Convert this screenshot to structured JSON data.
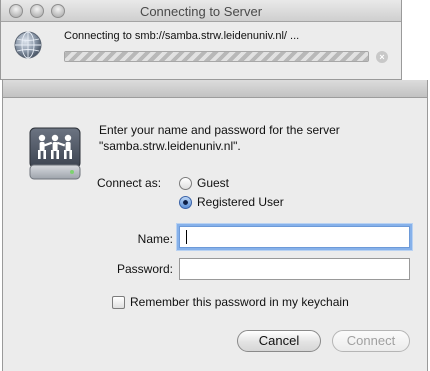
{
  "window": {
    "title": "Connecting to Server",
    "status_text": "Connecting to smb://samba.strw.leidenuniv.nl/ ..."
  },
  "progress": {
    "indeterminate": true
  },
  "dialog": {
    "prompt": "Enter your name and password for the server \"samba.strw.leidenuniv.nl\".",
    "connect_as_label": "Connect as:",
    "options": [
      {
        "label": "Guest",
        "selected": false
      },
      {
        "label": "Registered User",
        "selected": true
      }
    ],
    "name_label": "Name:",
    "name_value": "",
    "password_label": "Password:",
    "password_value": "",
    "remember_label": "Remember this password in my keychain",
    "remember_checked": false,
    "cancel_label": "Cancel",
    "connect_label": "Connect"
  },
  "icons": {
    "window": [
      "close-icon",
      "minimize-icon",
      "zoom-icon"
    ],
    "status": "network-globe-icon",
    "server": "shared-server-icon",
    "progress_stop": "stop-icon"
  },
  "colors": {
    "focus_ring": "#86b1ea",
    "radio_selected": "#5b8fd6"
  }
}
